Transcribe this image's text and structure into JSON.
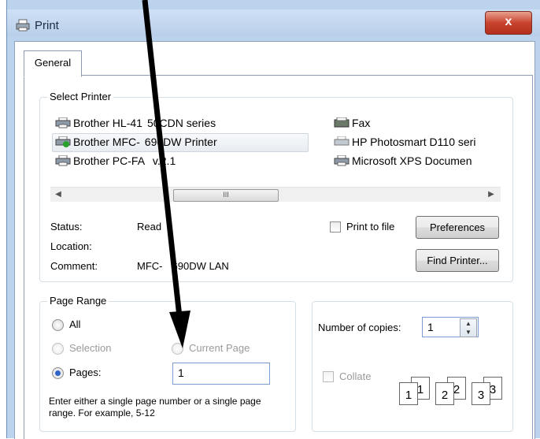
{
  "window": {
    "title": "Print",
    "close_label": "x"
  },
  "tabs": [
    {
      "label": "General"
    }
  ],
  "select_printer": {
    "legend": "Select Printer",
    "printers": [
      {
        "name": "Brother HL-4150CDN series"
      },
      {
        "name": "Brother MFC-9690DW Printer",
        "shown": "Brother MFC-",
        "tail": "690DW Printer"
      },
      {
        "name": "Brother PC-FAX v.2.1",
        "shown": "Brother PC-FA",
        "tail": " v.2.1"
      },
      {
        "name": "Fax"
      },
      {
        "name": "HP Photosmart D110 seri"
      },
      {
        "name": "Microsoft XPS Documen"
      }
    ],
    "printer_1_shown": "Brother HL-41",
    "printer_1_tail": "50CDN series",
    "scroll_thumb_label": "III",
    "status_label": "Status:",
    "status_value": "Read",
    "location_label": "Location:",
    "comment_label": "Comment:",
    "comment_value_a": "MFC-",
    "comment_value_b": "690DW LAN",
    "print_to_file_label": "Print to file",
    "preferences_label": "Preferences",
    "find_printer_label": "Find Printer..."
  },
  "page_range": {
    "legend": "Page Range",
    "all_label": "All",
    "selection_label": "Selection",
    "current_page_label": "Current Page",
    "pages_label": "Pages:",
    "pages_value": "1",
    "hint": "Enter either a single page number or a single page range.  For example, 5-12"
  },
  "copies": {
    "label": "Number of copies:",
    "value": "1",
    "collate_label": "Collate",
    "page_icons": [
      "1",
      "1",
      "2",
      "2",
      "3",
      "3"
    ]
  },
  "colors": {
    "accent": "#2e63c8",
    "titlebar": "#bcd3ee"
  }
}
